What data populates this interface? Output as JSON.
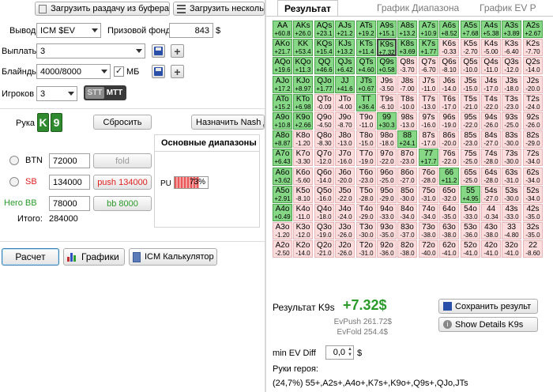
{
  "toolbar": {
    "load_clipboard": "Загрузить раздачу из буфера",
    "load_multiple": "Загрузить несколь"
  },
  "settings": {
    "output_label": "Вывод",
    "output_value": "ICM $EV",
    "prize_label": "Призовой фонд",
    "prize_value": "843",
    "prize_unit": "$",
    "payouts_label": "Выплаты",
    "payouts_value": "3",
    "blinds_label": "Блайнды",
    "blinds_value": "4000/8000",
    "mb_label": "МБ",
    "players_label": "Игроков",
    "players_value": "3",
    "stt_label": "STT",
    "mtt_label": "MTT"
  },
  "hand": {
    "label": "Рука",
    "card1": "K",
    "card2": "9",
    "reset_label": "Сбросить",
    "assign_nash_label": "Назначить Nash д"
  },
  "players": [
    {
      "pos": "BTN",
      "stack": "72000",
      "action": "fold",
      "action_color": "#9a9a9a",
      "pos_color": "#555555"
    },
    {
      "pos": "SB",
      "stack": "134000",
      "action": "push 134000",
      "action_color": "#e02020",
      "pos_color": "#e02020"
    },
    {
      "pos": "Hero BB",
      "stack": "78000",
      "action": "bb 8000",
      "action_color": "#2a9a2a",
      "pos_color": "#2a9a2a"
    }
  ],
  "total_label": "Итого:",
  "total_value": "284000",
  "ranges": {
    "title": "Основные диапазоны",
    "pu_label": "PU",
    "pu_value": "73%",
    "pu_fraction": 0.73
  },
  "actions": {
    "calc": "Расчет",
    "graphs": "Графики",
    "icm_calc": "ICM Калькулятор"
  },
  "tabs": [
    "Результат",
    "График Диапазона",
    "График EV P"
  ],
  "grid": {
    "rows": [
      [
        [
          "AA",
          "+60.8",
          1
        ],
        [
          "AKs",
          "+26.0",
          1
        ],
        [
          "AQs",
          "+23.1",
          1
        ],
        [
          "AJs",
          "+21.2",
          1
        ],
        [
          "ATs",
          "+19.2",
          1
        ],
        [
          "A9s",
          "+15.1",
          1
        ],
        [
          "A8s",
          "+13.2",
          1
        ],
        [
          "A7s",
          "+10.9",
          1
        ],
        [
          "A6s",
          "+8.52",
          1
        ],
        [
          "A5s",
          "+7.68",
          1
        ],
        [
          "A4s",
          "+5.38",
          1
        ],
        [
          "A3s",
          "+3.89",
          1
        ],
        [
          "A2s",
          "+2.67",
          1
        ]
      ],
      [
        [
          "AKo",
          "+21.7",
          1
        ],
        [
          "KK",
          "+53.4",
          1
        ],
        [
          "KQs",
          "+15.4",
          1
        ],
        [
          "KJs",
          "+13.2",
          1
        ],
        [
          "KTs",
          "+11.4",
          1
        ],
        [
          "K9s",
          "+7.32",
          2
        ],
        [
          "K8s",
          "+3.69",
          1
        ],
        [
          "K7s",
          "+1.77",
          1
        ],
        [
          "K6s",
          "-0.33",
          0
        ],
        [
          "K5s",
          "-2.70",
          0
        ],
        [
          "K4s",
          "-5.00",
          0
        ],
        [
          "K3s",
          "-6.40",
          0
        ],
        [
          "K2s",
          "-7.70",
          0
        ]
      ],
      [
        [
          "AQo",
          "+19.6",
          1
        ],
        [
          "KQo",
          "+11.3",
          1
        ],
        [
          "QQ",
          "+46.6",
          1
        ],
        [
          "QJs",
          "+6.42",
          1
        ],
        [
          "QTs",
          "+4.60",
          1
        ],
        [
          "Q9s",
          "+0.58",
          1
        ],
        [
          "Q8s",
          "-3.70",
          0
        ],
        [
          "Q7s",
          "-6.70",
          0
        ],
        [
          "Q6s",
          "-8.10",
          0
        ],
        [
          "Q5s",
          "-10.0",
          0
        ],
        [
          "Q4s",
          "-11.0",
          0
        ],
        [
          "Q3s",
          "-12.0",
          0
        ],
        [
          "Q2s",
          "-14.0",
          0
        ]
      ],
      [
        [
          "AJo",
          "+17.2",
          1
        ],
        [
          "KJo",
          "+8.97",
          1
        ],
        [
          "QJo",
          "+1.77",
          1
        ],
        [
          "JJ",
          "+41.6",
          1
        ],
        [
          "JTs",
          "+0.67",
          1
        ],
        [
          "J9s",
          "-3.50",
          0
        ],
        [
          "J8s",
          "-7.00",
          0
        ],
        [
          "J7s",
          "-11.0",
          0
        ],
        [
          "J6s",
          "-14.0",
          0
        ],
        [
          "J5s",
          "-15.0",
          0
        ],
        [
          "J4s",
          "-17.0",
          0
        ],
        [
          "J3s",
          "-18.0",
          0
        ],
        [
          "J2s",
          "-20.0",
          0
        ]
      ],
      [
        [
          "ATo",
          "+15.2",
          1
        ],
        [
          "KTo",
          "+6.98",
          1
        ],
        [
          "QTo",
          "-0.09",
          0
        ],
        [
          "JTo",
          "-4.00",
          0
        ],
        [
          "TT",
          "+36.4",
          1
        ],
        [
          "T9s",
          "-6.10",
          0
        ],
        [
          "T8s",
          "-10.0",
          0
        ],
        [
          "T7s",
          "-13.0",
          0
        ],
        [
          "T6s",
          "-17.0",
          0
        ],
        [
          "T5s",
          "-21.0",
          0
        ],
        [
          "T4s",
          "-22.0",
          0
        ],
        [
          "T3s",
          "-23.0",
          0
        ],
        [
          "T2s",
          "-24.0",
          0
        ]
      ],
      [
        [
          "A9o",
          "+10.8",
          1
        ],
        [
          "K9o",
          "+2.66",
          1
        ],
        [
          "Q9o",
          "-4.50",
          0
        ],
        [
          "J9o",
          "-8.70",
          0
        ],
        [
          "T9o",
          "-11.0",
          0
        ],
        [
          "99",
          "+30.3",
          1
        ],
        [
          "98s",
          "-13.0",
          0
        ],
        [
          "97s",
          "-16.0",
          0
        ],
        [
          "96s",
          "-19.0",
          0
        ],
        [
          "95s",
          "-22.0",
          0
        ],
        [
          "94s",
          "-26.0",
          0
        ],
        [
          "93s",
          "-25.0",
          0
        ],
        [
          "92s",
          "-26.0",
          0
        ]
      ],
      [
        [
          "A8o",
          "+8.87",
          1
        ],
        [
          "K8o",
          "-1.20",
          0
        ],
        [
          "Q8o",
          "-8.30",
          0
        ],
        [
          "J8o",
          "-13.0",
          0
        ],
        [
          "T8o",
          "-15.0",
          0
        ],
        [
          "98o",
          "-18.0",
          0
        ],
        [
          "88",
          "+24.1",
          1
        ],
        [
          "87s",
          "-17.0",
          0
        ],
        [
          "86s",
          "-20.0",
          0
        ],
        [
          "85s",
          "-23.0",
          0
        ],
        [
          "84s",
          "-27.0",
          0
        ],
        [
          "83s",
          "-30.0",
          0
        ],
        [
          "82s",
          "-29.0",
          0
        ]
      ],
      [
        [
          "A7o",
          "+6.43",
          1
        ],
        [
          "K7o",
          "-3.30",
          0
        ],
        [
          "Q7o",
          "-12.0",
          0
        ],
        [
          "J7o",
          "-16.0",
          0
        ],
        [
          "T7o",
          "-19.0",
          0
        ],
        [
          "97o",
          "-22.0",
          0
        ],
        [
          "87o",
          "-23.0",
          0
        ],
        [
          "77",
          "+17.7",
          1
        ],
        [
          "76s",
          "-22.0",
          0
        ],
        [
          "75s",
          "-25.0",
          0
        ],
        [
          "74s",
          "-28.0",
          0
        ],
        [
          "73s",
          "-30.0",
          0
        ],
        [
          "72s",
          "-34.0",
          0
        ]
      ],
      [
        [
          "A6o",
          "+3.62",
          1
        ],
        [
          "K6o",
          "-5.60",
          0
        ],
        [
          "Q6o",
          "-14.0",
          0
        ],
        [
          "J6o",
          "-20.0",
          0
        ],
        [
          "T6o",
          "-23.0",
          0
        ],
        [
          "96o",
          "-25.0",
          0
        ],
        [
          "86o",
          "-27.0",
          0
        ],
        [
          "76o",
          "-28.0",
          0
        ],
        [
          "66",
          "+11.2",
          1
        ],
        [
          "65s",
          "-25.0",
          0
        ],
        [
          "64s",
          "-28.0",
          0
        ],
        [
          "63s",
          "-31.0",
          0
        ],
        [
          "62s",
          "-34.0",
          0
        ]
      ],
      [
        [
          "A5o",
          "+2.91",
          1
        ],
        [
          "K5o",
          "-8.10",
          0
        ],
        [
          "Q5o",
          "-16.0",
          0
        ],
        [
          "J5o",
          "-22.0",
          0
        ],
        [
          "T5o",
          "-28.0",
          0
        ],
        [
          "95o",
          "-29.0",
          0
        ],
        [
          "85o",
          "-30.0",
          0
        ],
        [
          "75o",
          "-31.0",
          0
        ],
        [
          "65o",
          "-32.0",
          0
        ],
        [
          "55",
          "+4.95",
          1
        ],
        [
          "54s",
          "-27.0",
          0
        ],
        [
          "53s",
          "-30.0",
          0
        ],
        [
          "52s",
          "-34.0",
          0
        ]
      ],
      [
        [
          "A4o",
          "+0.49",
          1
        ],
        [
          "K4o",
          "-11.0",
          0
        ],
        [
          "Q4o",
          "-18.0",
          0
        ],
        [
          "J4o",
          "-24.0",
          0
        ],
        [
          "T4o",
          "-29.0",
          0
        ],
        [
          "94o",
          "-33.0",
          0
        ],
        [
          "84o",
          "-34.0",
          0
        ],
        [
          "74o",
          "-34.0",
          0
        ],
        [
          "64o",
          "-35.0",
          0
        ],
        [
          "54o",
          "-33.0",
          0
        ],
        [
          "44",
          "-0.34",
          0
        ],
        [
          "43s",
          "-33.0",
          0
        ],
        [
          "42s",
          "-35.0",
          0
        ]
      ],
      [
        [
          "A3o",
          "-1.20",
          0
        ],
        [
          "K3o",
          "-12.0",
          0
        ],
        [
          "Q3o",
          "-19.0",
          0
        ],
        [
          "J3o",
          "-26.0",
          0
        ],
        [
          "T3o",
          "-30.0",
          0
        ],
        [
          "93o",
          "-35.0",
          0
        ],
        [
          "83o",
          "-37.0",
          0
        ],
        [
          "73o",
          "-38.0",
          0
        ],
        [
          "63o",
          "-38.0",
          0
        ],
        [
          "53o",
          "-36.0",
          0
        ],
        [
          "43o",
          "-38.0",
          0
        ],
        [
          "33",
          "-4.80",
          0
        ],
        [
          "32s",
          "-35.0",
          0
        ]
      ],
      [
        [
          "A2o",
          "-2.50",
          0
        ],
        [
          "K2o",
          "-14.0",
          0
        ],
        [
          "Q2o",
          "-21.0",
          0
        ],
        [
          "J2o",
          "-26.0",
          0
        ],
        [
          "T2o",
          "-31.0",
          0
        ],
        [
          "92o",
          "-36.0",
          0
        ],
        [
          "82o",
          "-38.0",
          0
        ],
        [
          "72o",
          "-40.0",
          0
        ],
        [
          "62o",
          "-41.0",
          0
        ],
        [
          "52o",
          "-41.0",
          0
        ],
        [
          "42o",
          "-41.0",
          0
        ],
        [
          "32o",
          "-41.0",
          0
        ],
        [
          "22",
          "-8.60",
          0
        ]
      ]
    ]
  },
  "result": {
    "label": "Результат K9s",
    "value": "+7.32$",
    "evpush": "EvPush 261.72$",
    "evfold": "EvFold 254.4$",
    "save_label": "Сохранить результ",
    "details_label": "Show Details K9s",
    "min_ev_label": "min EV Diff",
    "min_ev_value": "0,0",
    "min_ev_unit": "$",
    "hero_hands_label": "Руки героя:",
    "hero_hands_value": "(24,7%) 55+,A2s+,A4o+,K7s+,K9o+,Q9s+,QJo,JTs"
  },
  "colors": {
    "positive_cell": "#86d886",
    "negative_cell": "#fcdcdc",
    "result_green": "#2a9a2a"
  }
}
